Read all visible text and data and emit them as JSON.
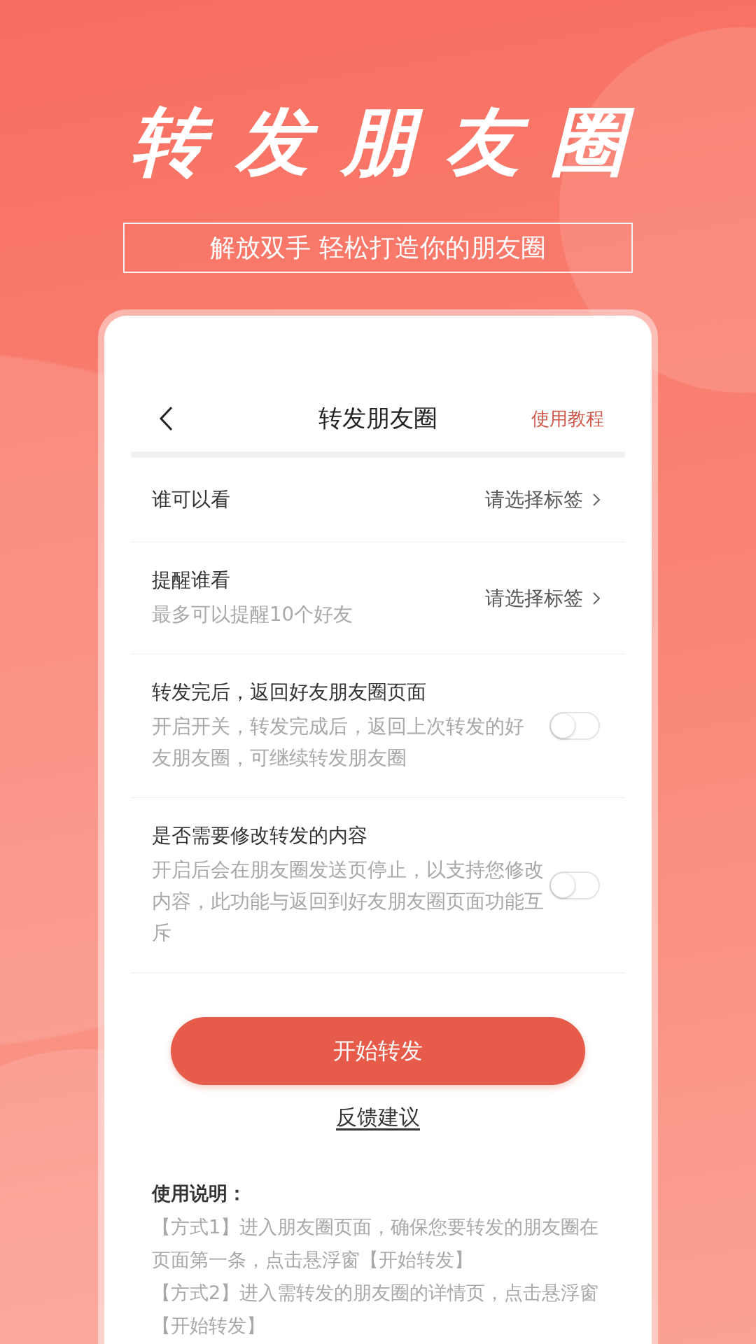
{
  "hero": {
    "title": "转发朋友圈",
    "subtitle": "解放双手 轻松打造你的朋友圈"
  },
  "header": {
    "title": "转发朋友圈",
    "tutorial_link": "使用教程"
  },
  "settings": [
    {
      "kind": "select",
      "label": "谁可以看",
      "value": "请选择标签"
    },
    {
      "kind": "select",
      "label": "提醒谁看",
      "hint": "最多可以提醒10个好友",
      "value": "请选择标签"
    },
    {
      "kind": "toggle",
      "label": "转发完后，返回好友朋友圈页面",
      "hint": "开启开关，转发完成后，返回上次转发的好友朋友圈，可继续转发朋友圈",
      "on": false
    },
    {
      "kind": "toggle",
      "label": "是否需要修改转发的内容",
      "hint": "开启后会在朋友圈发送页停止，以支持您修改内容，此功能与返回到好友朋友圈页面功能互斥",
      "on": false
    }
  ],
  "start_button": "开始转发",
  "feedback_link": "反馈建议",
  "instructions": {
    "title": "使用说明：",
    "lines": [
      "【方式1】进入朋友圈页面，确保您要转发的朋友圈在页面第一条，点击悬浮窗【开始转发】",
      "【方式2】进入需转发的朋友圈的详情页，点击悬浮窗【开始转发】"
    ]
  }
}
